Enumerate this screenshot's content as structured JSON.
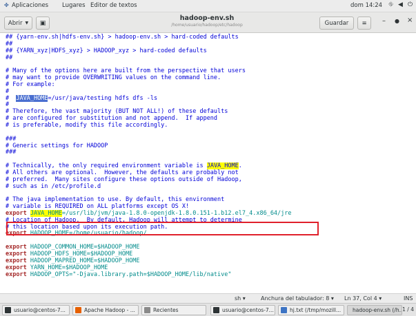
{
  "topbar": {
    "apps_label": "Aplicaciones",
    "places_label": "Lugares",
    "editor_label": "Editor de textos",
    "clock": "dom 14:24"
  },
  "header": {
    "open_label": "Abrir",
    "save_label": "Guardar",
    "title": "hadoop-env.sh",
    "subtitle": "/home/usuario/hadoop/etc/hadoop"
  },
  "editor": {
    "lines": [
      [
        {
          "t": "## {yarn-env.sh|hdfs-env.sh} > hadoop-env.sh > hard-coded defaults",
          "c": "c"
        }
      ],
      [
        {
          "t": "##",
          "c": "c"
        }
      ],
      [
        {
          "t": "## {YARN_xyz|HDFS_xyz} > HADOOP_xyz > hard-coded defaults",
          "c": "c"
        }
      ],
      [
        {
          "t": "##",
          "c": "c"
        }
      ],
      [
        {
          "t": "",
          "c": "c"
        }
      ],
      [
        {
          "t": "# Many of the options here are built from the perspective that users",
          "c": "c"
        }
      ],
      [
        {
          "t": "# may want to provide OVERWRITING values on the command line.",
          "c": "c"
        }
      ],
      [
        {
          "t": "# For example:",
          "c": "c"
        }
      ],
      [
        {
          "t": "#",
          "c": "c"
        }
      ],
      [
        {
          "t": "#  ",
          "c": "c"
        },
        {
          "t": "JAVA_HOME",
          "c": "hlsel"
        },
        {
          "t": "=/usr/java/testing hdfs dfs -ls",
          "c": "c"
        }
      ],
      [
        {
          "t": "#",
          "c": "c"
        }
      ],
      [
        {
          "t": "# Therefore, the vast majority (BUT NOT ALL!) of these defaults",
          "c": "c"
        }
      ],
      [
        {
          "t": "# are configured for substitution and not append.  If append",
          "c": "c"
        }
      ],
      [
        {
          "t": "# is preferable, modify this file accordingly.",
          "c": "c"
        }
      ],
      [
        {
          "t": "",
          "c": "c"
        }
      ],
      [
        {
          "t": "###",
          "c": "c"
        }
      ],
      [
        {
          "t": "# Generic settings for HADOOP",
          "c": "c"
        }
      ],
      [
        {
          "t": "###",
          "c": "c"
        }
      ],
      [
        {
          "t": "",
          "c": "c"
        }
      ],
      [
        {
          "t": "# Technically, the only required environment variable is ",
          "c": "c"
        },
        {
          "t": "JAVA_HOME",
          "c": "c hlyel"
        },
        {
          "t": ".",
          "c": "c"
        }
      ],
      [
        {
          "t": "# All others are optional.  However, the defaults are probably not",
          "c": "c"
        }
      ],
      [
        {
          "t": "# preferred.  Many sites configure these options outside of Hadoop,",
          "c": "c"
        }
      ],
      [
        {
          "t": "# such as in /etc/profile.d",
          "c": "c"
        }
      ],
      [
        {
          "t": "",
          "c": "c"
        }
      ],
      [
        {
          "t": "# The java implementation to use. By default, this environment",
          "c": "c"
        }
      ],
      [
        {
          "t": "# variable is REQUIRED on ALL platforms except OS X!",
          "c": "c"
        }
      ],
      [
        {
          "t": "export ",
          "c": "k"
        },
        {
          "t": "JAVA_HOME",
          "c": "v hlyel"
        },
        {
          "t": "=/usr/lib/jvm/java-1.8.0-openjdk-1.8.0.151-1.b12.el7_4.x86_64/jre",
          "c": "v"
        }
      ],
      [
        {
          "t": "# Location of Hadoop.  By default, Hadoop will attempt to determine",
          "c": "c"
        }
      ],
      [
        {
          "t": "# this location based upon its execution path.",
          "c": "c"
        }
      ],
      [
        {
          "t": "export ",
          "c": "k"
        },
        {
          "t": "HADOOP_HOME=/home/usuario/hadoop/",
          "c": "v"
        }
      ],
      [
        {
          "t": "",
          "c": "c"
        }
      ],
      [
        {
          "t": "export ",
          "c": "k"
        },
        {
          "t": "HADOOP_COMMON_HOME=$HADOOP_HOME",
          "c": "v"
        }
      ],
      [
        {
          "t": "export ",
          "c": "k"
        },
        {
          "t": "HADOOP_HDFS_HOME=$HADOOP_HOME",
          "c": "v"
        }
      ],
      [
        {
          "t": "export ",
          "c": "k"
        },
        {
          "t": "HADOOP_MAPRED_HOME=$HADOOP_HOME",
          "c": "v"
        }
      ],
      [
        {
          "t": "export ",
          "c": "k"
        },
        {
          "t": "YARN_HOME=$HADOOP_HOME",
          "c": "v"
        }
      ],
      [
        {
          "t": "export ",
          "c": "k"
        },
        {
          "t": "HADOOP_OPTS=\"-Djava.library.path=$HADOOP_HOME/lib/native\"",
          "c": "v"
        }
      ]
    ]
  },
  "statusbar": {
    "language": "sh",
    "tab_width": "Anchura del tabulador: 8",
    "position": "Ln 37, Col 4",
    "mode": "INS"
  },
  "taskbar": {
    "items": [
      {
        "label": "usuario@centos-7...",
        "icon": "terminal-icon",
        "color": "#2e3436"
      },
      {
        "label": "Apache Hadoop - ...",
        "icon": "firefox-icon",
        "color": "#e66000"
      },
      {
        "label": "Recientes",
        "icon": "folder-icon",
        "color": "#8a8a8a"
      },
      {
        "label": "usuario@centos-7...",
        "icon": "terminal-icon",
        "color": "#2e3436"
      },
      {
        "label": "hj.txt (/tmp/mozill...",
        "icon": "text-editor-icon",
        "color": "#3d74c4"
      },
      {
        "label": "hadoop-env.sh (/h...",
        "icon": "text-editor-icon",
        "color": "#3d74c4"
      }
    ],
    "pager": "1 / 4"
  }
}
